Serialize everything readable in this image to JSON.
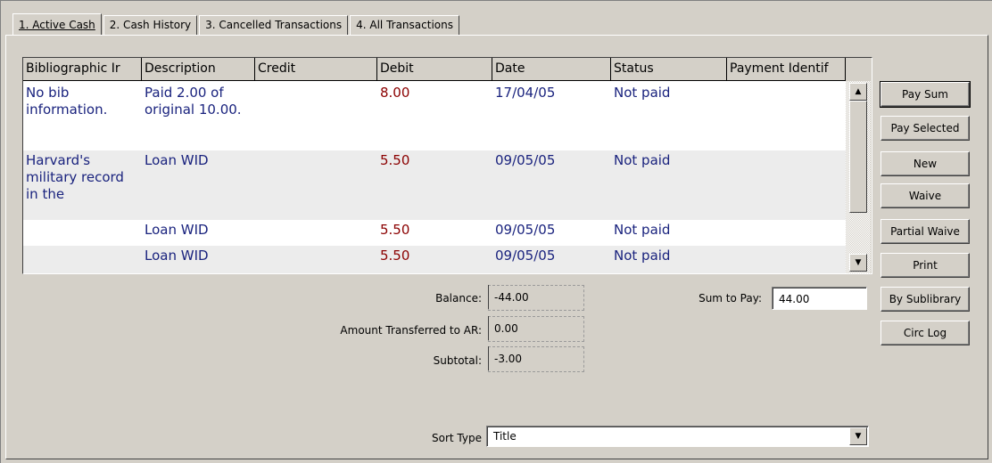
{
  "tabs": [
    {
      "label": "1. Active Cash",
      "active": true
    },
    {
      "label": "2. Cash History",
      "active": false
    },
    {
      "label": "3. Cancelled Transactions",
      "active": false
    },
    {
      "label": "4. All Transactions",
      "active": false
    }
  ],
  "grid": {
    "columns": [
      "Bibliographic Ir",
      "Description",
      "Credit",
      "Debit",
      "Date",
      "Status",
      "Payment Identif"
    ],
    "rows": [
      {
        "bib": "No bib information.",
        "description": "Paid 2.00 of original 10.00.",
        "credit": "",
        "debit": "8.00",
        "date": "17/04/05",
        "status": "Not paid",
        "payment_id": ""
      },
      {
        "bib": "Harvard's military record in the",
        "description": "Loan WID",
        "credit": "",
        "debit": "5.50",
        "date": "09/05/05",
        "status": "Not paid",
        "payment_id": ""
      },
      {
        "bib": "",
        "description": "Loan WID",
        "credit": "",
        "debit": "5.50",
        "date": "09/05/05",
        "status": "Not paid",
        "payment_id": ""
      },
      {
        "bib": "",
        "description": "Loan WID",
        "credit": "",
        "debit": "5.50",
        "date": "09/05/05",
        "status": "Not paid",
        "payment_id": ""
      }
    ],
    "scroll_up_icon": "triangle-up",
    "scroll_down_icon": "triangle-down"
  },
  "buttons": {
    "pay_sum": "Pay Sum",
    "pay_selected": "Pay Selected",
    "new": "New",
    "waive": "Waive",
    "partial_waive": "Partial Waive",
    "print": "Print",
    "by_sublibrary": "By Sublibrary",
    "circ_log": "Circ Log"
  },
  "totals": {
    "balance_label": "Balance:",
    "balance_value": "-44.00",
    "transferred_label": "Amount Transferred to AR:",
    "transferred_value": "0.00",
    "subtotal_label": "Subtotal:",
    "subtotal_value": "-3.00",
    "sum_to_pay_label": "Sum to Pay:",
    "sum_to_pay_value": "44.00"
  },
  "sort": {
    "label": "Sort Type",
    "value": "Title"
  },
  "colors": {
    "text_blue": "#1a237e",
    "debit_red": "#8b0000",
    "alt_row": "#ececec",
    "window_bg": "#d4d0c8"
  }
}
